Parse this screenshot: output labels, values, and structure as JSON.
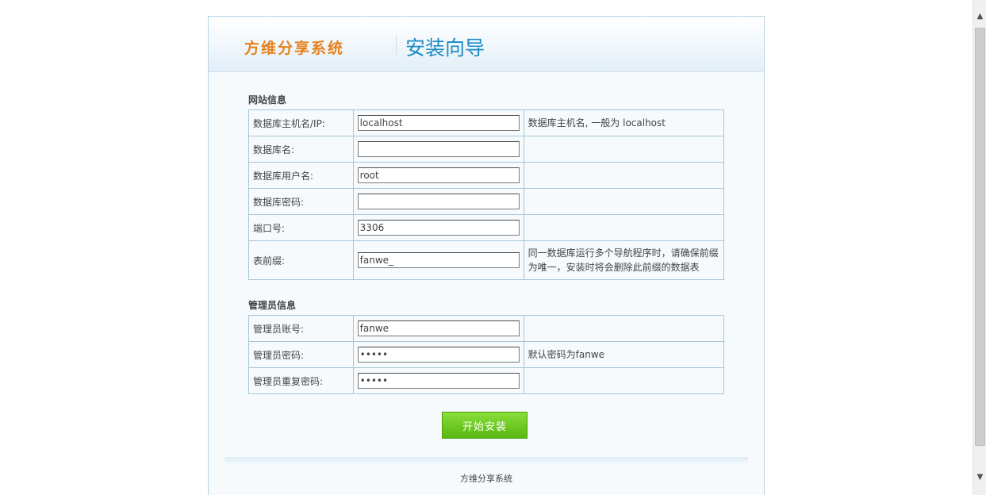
{
  "header": {
    "brand": "方维分享系统",
    "wizard_title": "安装向导"
  },
  "site_info": {
    "title": "网站信息",
    "rows": [
      {
        "label": "数据库主机名/IP:",
        "value": "localhost",
        "placeholder": "",
        "hint": "数据库主机名, 一般为 localhost"
      },
      {
        "label": "数据库名:",
        "value": "",
        "placeholder": "",
        "hint": ""
      },
      {
        "label": "数据库用户名:",
        "value": "root",
        "placeholder": "",
        "hint": ""
      },
      {
        "label": "数据库密码:",
        "value": "",
        "placeholder": "",
        "hint": ""
      },
      {
        "label": "端口号:",
        "value": "3306",
        "placeholder": "",
        "hint": ""
      },
      {
        "label": "表前缀:",
        "value": "fanwe_",
        "placeholder": "",
        "hint": "同一数据库运行多个导航程序时，请确保前缀为唯一，安装时将会删除此前缀的数据表"
      }
    ]
  },
  "admin_info": {
    "title": "管理员信息",
    "rows": [
      {
        "label": "管理员账号:",
        "value": "fanwe",
        "hint": ""
      },
      {
        "label": "管理员密码:",
        "value": "fanwe",
        "hint": "默认密码为fanwe"
      },
      {
        "label": "管理员重复密码:",
        "value": "fanwe",
        "hint": ""
      }
    ]
  },
  "install_button": "开始安装",
  "footer": "方维分享系统",
  "scrollbar": {
    "up_icon": "▲",
    "down_icon": "▼"
  }
}
